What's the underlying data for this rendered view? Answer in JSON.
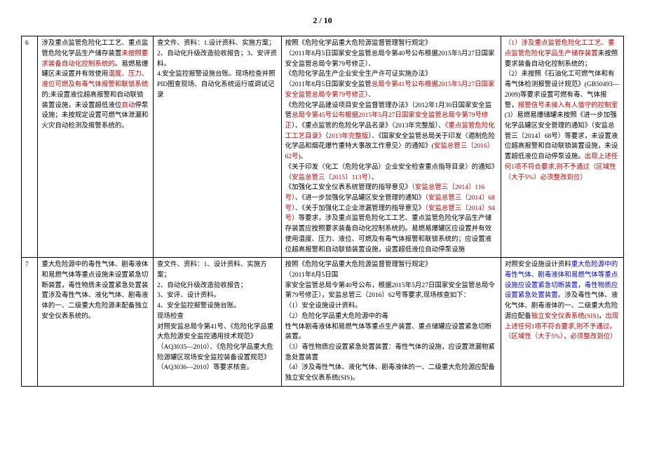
{
  "page_number": "2 / 10",
  "rows": [
    {
      "id": "6",
      "col2": [
        {
          "t": "涉及重点监管危险化工工艺、重点监管危险化学品生产储存装置"
        },
        {
          "t": "未按照要求装备自动化控制系统的",
          "c": "red"
        },
        {
          "t": "。易燃易爆罐区未设置并有效使用"
        },
        {
          "t": "温度、压力、液位可燃及有毒气体报警和联锁系统",
          "c": "red"
        },
        {
          "t": "的;未设置液位超高报警和自动联锁装置设施，未设置超低液位"
        },
        {
          "t": "自动",
          "c": "red"
        },
        {
          "t": "停泵设施；未按规定设置可燃气体泄漏和火灾自动检测及报警系统的。"
        }
      ],
      "col3": [
        {
          "t": "查文件、资料：1.设计资料、实施方案；\n2、自动化升级改造验收报告；3、安评资料。\n4.安全监控报警设施台账。现场检查并照PID图查现场、自动化系统运行或调试记录"
        }
      ],
      "col4": [
        {
          "t": "按照《危险化学品重大危险源监督管理暂行规定》\n（2011年8月5日国家安全监管总局令第40号公布根据2015年5月27日国家安全监管总局令第79号修正）、\n《危险化学品生产企业安全生产许可证实施办法》\n（2011年8月5日国家安全监管"
        },
        {
          "t": "总局令第41号公布根据2015年5月27日国家安全监管总局令第79号修正",
          "c": "red"
        },
        {
          "t": "）、\n《危险化学品建设项目安全监督管理办法》（2012年1月30日国家安全监管"
        },
        {
          "t": "总局令第45号公布根据2015年5月27日国家安全监管总局令第79号修正",
          "c": "red"
        },
        {
          "t": "）、《重点监管的危险化学品名录》（2013年完整版）、"
        },
        {
          "t": "《重点监管危险化工工艺目录》",
          "c": "red"
        },
        {
          "t": "（"
        },
        {
          "t": "2013年完整版",
          "c": "red"
        },
        {
          "t": "）、《国家安全监管总局关于印发〈遏制危险化学品和烟花爆竹重特大事故工作意见〉的通知》("
        },
        {
          "t": "安监总管三〔2016〕62号",
          "c": "red"
        },
        {
          "t": ")、\n《关于印发〈化工（危险化学品）企业安全检查重点指导目录〉的通知》（"
        },
        {
          "t": "安监总管三〔2015〕113号）",
          "c": "red"
        },
        {
          "t": "、\n《加强化工安全仪表系统管理的指导意见》"
        },
        {
          "t": "（安监总管三〔2014〕116号）",
          "c": "red"
        },
        {
          "t": "、《进一步加强化学品罐区安全管理的通知》"
        },
        {
          "t": "（安监总管三〔2014〕68号）",
          "c": "red"
        },
        {
          "t": "、《关于加强化工企业泄漏管理的指导意见》"
        },
        {
          "t": "（安监总管三〔2014〕94号）",
          "c": "red"
        },
        {
          "t": "等要求，涉及重点监管危险化工工艺、重点监管危险化学品生产储存装置应按照要求装备自动化控制系统的。易燃易爆罐区应设置并有效使用温度、压力、液位、可燃及有毒气体报警和联锁系统的；应设置液位超高报警和自动联锁装置设施，设置超低液位自动停泵设施"
        }
      ],
      "col5": [
        {
          "t": "（1）涉及",
          "c": "red"
        },
        {
          "t": "重点监管危险化工工艺、重点监管危险化学品生产储存装置",
          "c": "red"
        },
        {
          "t": "未按照要求装备自动化控制系统的；\n（2）未按照《石油化工可燃气体和有毒气体检测报警设计规范》(GB50493—2009)等要求设置可燃有毒、气体报警，"
        },
        {
          "t": "报警信号未接入有人值守的控制室",
          "c": "red"
        },
        {
          "t": "(3）易燃易爆储罐未按照《进一步加强化学品罐区安全管理的通知》（安监总管三〔2014〕68号）等要求，未设置液位超高报警和自动联锁装置设施，未设置超低液位自动停泵设施。"
        },
        {
          "t": "出现上述任何1项不符合要求,则不予通过（区域性（大于5%）必须整改到位）",
          "c": "red"
        }
      ]
    },
    {
      "id": "7",
      "col2": [
        {
          "t": "重大危险源中的毒性气体、剧毒液体和易燃气体等重点设施未设置紧急切断装置，毒性物质未设置紧急处置装置涉及毒性气体、液化气体、剧毒液体的一、二级重大危险源未配备独立安全仪表系统的。"
        }
      ],
      "col3": [
        {
          "t": "查文件、资料：1、设计资料、实施方案；\n2、自动化升级改造验收报告；\n3、安评、设计资料。\n4、安全监控报警设施台账。\n现场检查\n对照安监总局令第41号、《危险化学品重大危险源安全监控通用技术规范》（AQ3035—2010）、《危险化学品重大危险源罐区现场安全监控装备设置规范》（AQ3036—2010）等要求核查。"
        }
      ],
      "col4": [
        {
          "t": "按照《危险化学品重大危险源监督管理暂行规定》\n（2011年8月5日国\n家安全监管总局令第40号公布，根据2015年5月27日国家安全监管总局令\n第79号修正），安监总管三〔2016〕62号等要求,现场核查如下：\n（1）安全设施设计资料。\n（2）危险化学品重大危险源中的毒\n性气体剧毒液体和易燃气体等重点生产装置、重点储罐应设置紧急切断装置。\n（3）毒性物质应设置紧急处置装置：毒性气体的设施，应设置泄漏物紧\n急处置装置\n（4）涉及毒性气体、液化气体、剧毒液体的一、二级重大危险源应配备独立安全仪表系统(SIS)。"
        }
      ],
      "col5": [
        {
          "t": "对照安全设施设计资料"
        },
        {
          "t": "重大危险源中的毒性气体、剧毒液体和易燃气体等重点设施应设置紧急切断装置，毒性物质应设置紧急处置装置",
          "c": "blue"
        },
        {
          "t": "。涉及毒性气体、液化气体、剧毒液体的一、二级重大危险源应配备"
        },
        {
          "t": "独立安全仪表系统(SIS)",
          "c": "red"
        },
        {
          "t": "，"
        },
        {
          "t": "出现上述任何1项不符合要求,则不予通过。（区域性（大于5%），必须整改到位）",
          "c": "red"
        }
      ]
    }
  ]
}
